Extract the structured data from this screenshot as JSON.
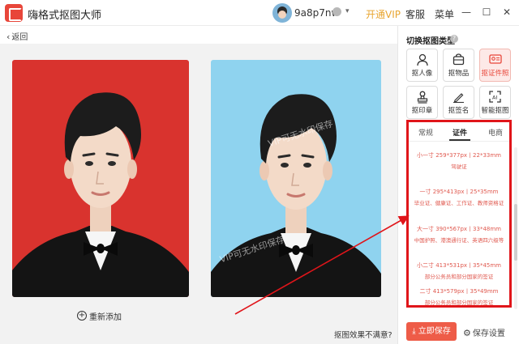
{
  "app": {
    "title": "嗨格式抠图大师",
    "username": "9a8p7nw",
    "vip_link": "开通VIP",
    "service_link": "客服",
    "menu_link": "菜单",
    "minimize": "—",
    "maximize": "☐",
    "close": "✕"
  },
  "toolbar": {
    "back_icon": "‹",
    "back_label": "返回"
  },
  "canvas": {
    "readd_label": "重新添加",
    "readd_icon": "+",
    "feedback_link": "抠图效果不满意?",
    "watermark_text": "VIP可无水印保存",
    "original_bg": "#d9332e",
    "result_bg": "#8fd3ef"
  },
  "panel": {
    "title": "切换抠图类型",
    "help_icon": "?",
    "types": [
      {
        "label": "抠人像",
        "icon": "person-icon",
        "glyph": "👤"
      },
      {
        "label": "抠物品",
        "icon": "bag-icon",
        "glyph": "⊡"
      },
      {
        "label": "抠证件照",
        "icon": "id-card-icon",
        "glyph": "▣"
      },
      {
        "label": "抠印章",
        "icon": "stamp-icon",
        "glyph": "♜"
      },
      {
        "label": "抠签名",
        "icon": "pen-icon",
        "glyph": "✎"
      },
      {
        "label": "智能抠图",
        "icon": "smart-crop-icon",
        "glyph": "⛶"
      }
    ],
    "active_type": "抠证件照",
    "size_tabs": [
      "常规",
      "证件",
      "电商"
    ],
    "active_size_tab": "证件",
    "sizes": [
      {
        "line1": "小一寸 259*377px丨22*33mm",
        "line2": "驾驶证"
      },
      {
        "line1": "一寸 295*413px丨25*35mm",
        "line2": "毕业证、健康证、工作证、教师资格证"
      },
      {
        "line1": "大一寸 390*567px丨33*48mm",
        "line2": "中国护照、港澳通行证、英语四六级等"
      },
      {
        "line1": "小二寸 413*531px丨35*45mm",
        "line2": "部分公务员和部分国家的签证"
      },
      {
        "line1": "二寸 413*579px丨35*49mm",
        "line2": "部分公务员和部分国家的签证"
      }
    ],
    "save_button": "立即保存",
    "save_icon": "⤓",
    "save_settings": "保存设置",
    "accent": "#e8463a",
    "highlight_border": "#e0151a"
  }
}
